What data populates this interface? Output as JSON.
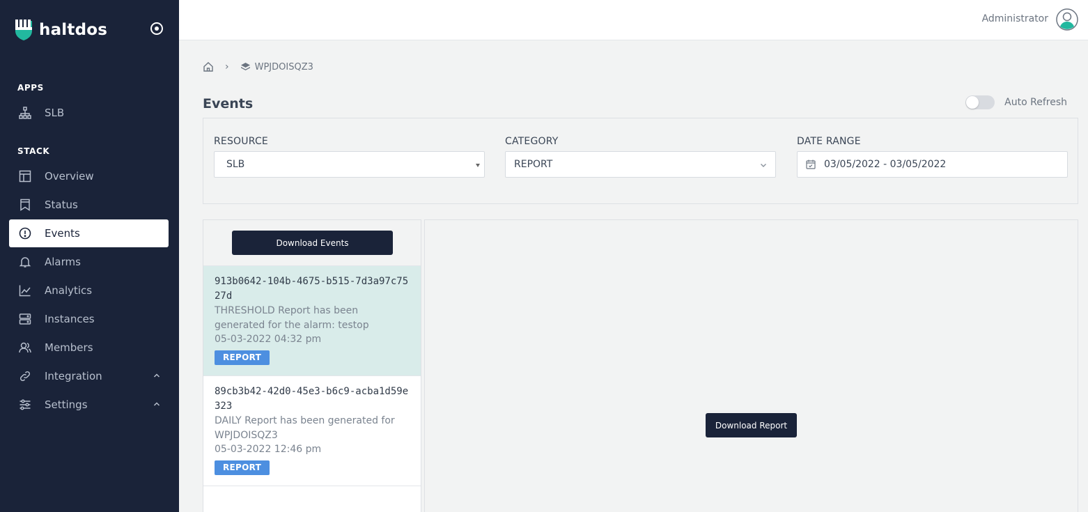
{
  "brand": {
    "name": "haltdos",
    "colors": {
      "sidebar": "#1a2339",
      "logo_accent": "#22b89f",
      "tag": "#4d8fe0",
      "selected_row": "#d9ecea"
    }
  },
  "sidebar": {
    "apps_title": "APPS",
    "apps": [
      {
        "label": "SLB",
        "icon": "sitemap-icon"
      }
    ],
    "stack_title": "STACK",
    "items": [
      {
        "label": "Overview",
        "icon": "layout-icon"
      },
      {
        "label": "Status",
        "icon": "bookmark-icon"
      },
      {
        "label": "Events",
        "icon": "alert-circle-icon",
        "active": true
      },
      {
        "label": "Alarms",
        "icon": "bell-icon"
      },
      {
        "label": "Analytics",
        "icon": "chart-line-icon"
      },
      {
        "label": "Instances",
        "icon": "server-icon"
      },
      {
        "label": "Members",
        "icon": "users-icon"
      },
      {
        "label": "Integration",
        "icon": "link-icon",
        "expandable": true
      },
      {
        "label": "Settings",
        "icon": "sliders-icon",
        "expandable": true
      }
    ]
  },
  "topbar": {
    "user": "Administrator"
  },
  "breadcrumb": {
    "current": "WPJDOISQZ3",
    "separator": "›"
  },
  "page": {
    "title": "Events",
    "auto_refresh_label": "Auto Refresh",
    "auto_refresh_on": false
  },
  "filters": {
    "resource": {
      "label": "RESOURCE",
      "value": "SLB"
    },
    "category": {
      "label": "CATEGORY",
      "value": "REPORT"
    },
    "date_range": {
      "label": "DATE RANGE",
      "value": "03/05/2022 - 03/05/2022"
    }
  },
  "events": {
    "download_label": "Download Events",
    "items": [
      {
        "id": "913b0642-104b-4675-b515-7d3a97c7527d",
        "message": "THRESHOLD Report has been generated for the alarm: testop",
        "time": "05-03-2022 04:32 pm",
        "tag": "REPORT",
        "selected": true
      },
      {
        "id": "89cb3b42-42d0-45e3-b6c9-acba1d59e323",
        "message": "DAILY Report has been generated for WPJDOISQZ3",
        "time": "05-03-2022 12:46 pm",
        "tag": "REPORT",
        "selected": false
      }
    ]
  },
  "detail": {
    "download_label": "Download Report"
  }
}
